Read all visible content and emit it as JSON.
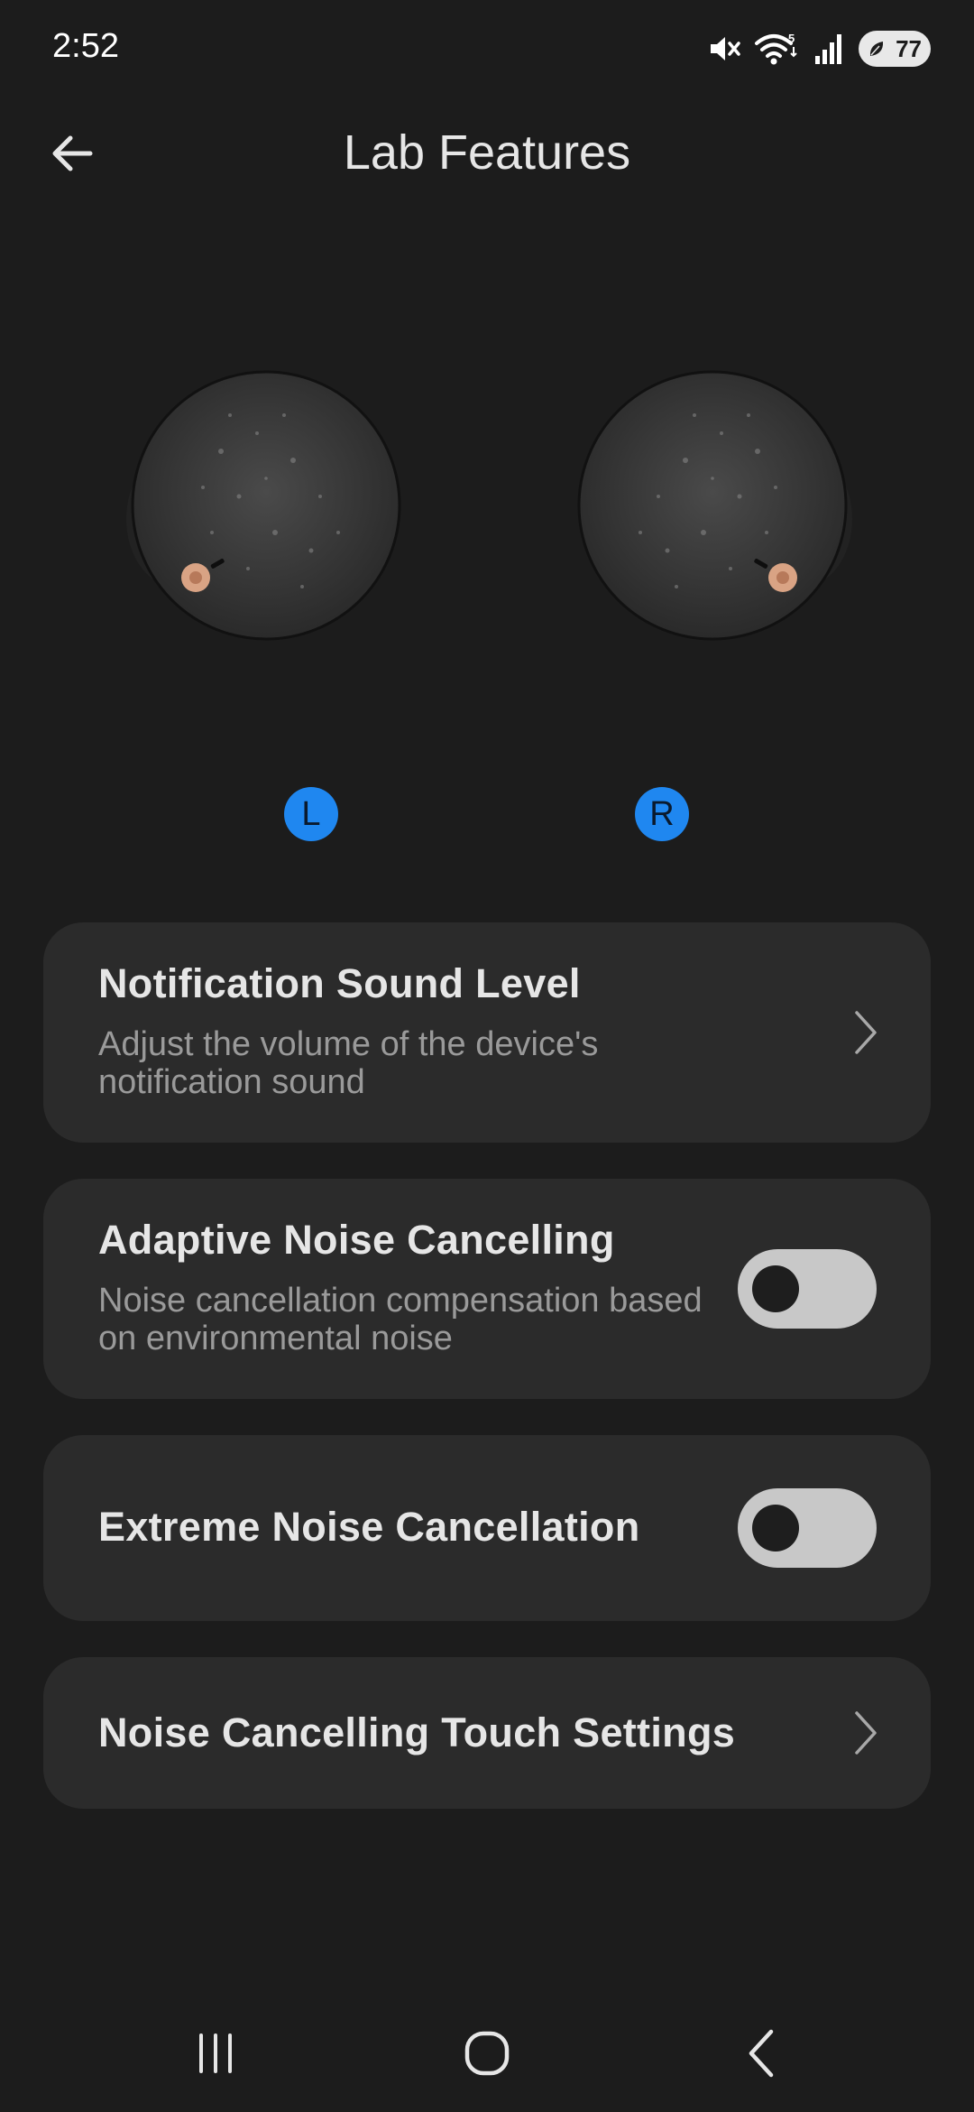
{
  "status_bar": {
    "time": "2:52",
    "wifi_badge": "5",
    "battery_level": "77",
    "icons": [
      "mute-icon",
      "wifi-icon",
      "signal-icon",
      "battery-saver-icon"
    ]
  },
  "app_bar": {
    "title": "Lab Features",
    "back_icon": "arrow-left-icon"
  },
  "earbuds": {
    "left_label": "L",
    "right_label": "R",
    "badge_color": "#1f87f0"
  },
  "settings": [
    {
      "title": "Notification Sound Level",
      "description": "Adjust the volume of the device's notification sound",
      "control": "chevron"
    },
    {
      "title": "Adaptive Noise Cancelling",
      "description": "Noise cancellation compensation based on environmental noise",
      "control": "toggle",
      "enabled": false
    },
    {
      "title": "Extreme Noise Cancellation",
      "control": "toggle",
      "enabled": false
    },
    {
      "title": "Noise Cancelling Touch Settings",
      "control": "chevron"
    }
  ],
  "nav_bar": {
    "buttons": [
      "recents-icon",
      "home-icon",
      "back-icon"
    ]
  },
  "colors": {
    "background": "#1c1c1c",
    "card": "#2b2b2b",
    "accent": "#1f87f0",
    "toggle_off": "#c8c8c8"
  }
}
